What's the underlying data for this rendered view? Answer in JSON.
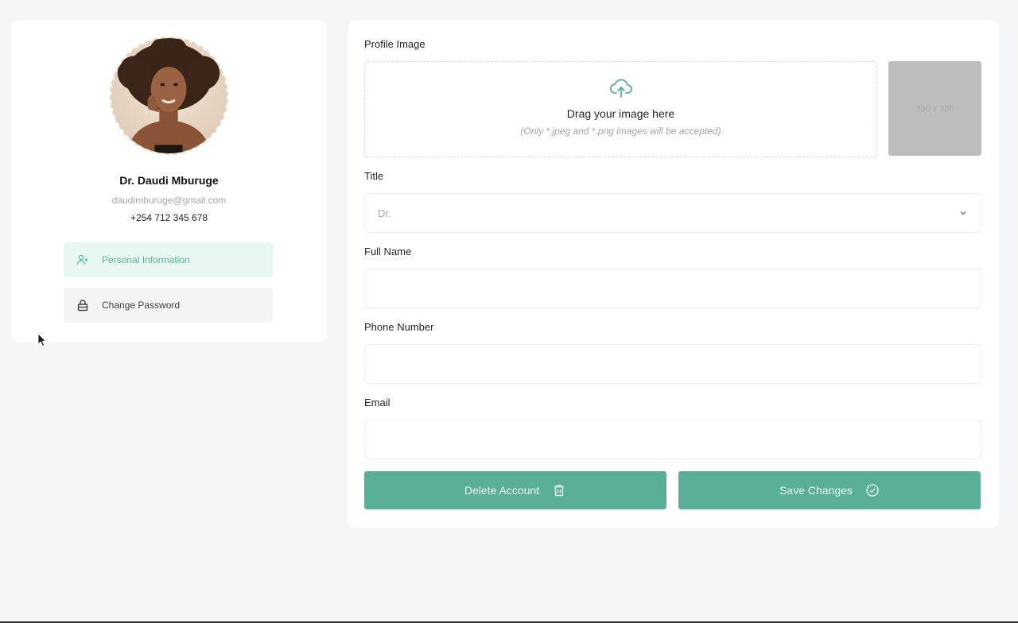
{
  "profile": {
    "name": "Dr. Daudi Mburuge",
    "email": "daudimburuge@gmail.com",
    "phone": "+254 712 345 678",
    "avatar_icon": "profile-photo"
  },
  "menu": {
    "items": [
      {
        "label": "Personal Information",
        "icon": "user-plus-icon",
        "active": true
      },
      {
        "label": "Change Password",
        "icon": "lock-icon",
        "active": false
      }
    ]
  },
  "form": {
    "profile_image_label": "Profile Image",
    "dropzone": {
      "title": "Drag your image here",
      "hint": "(Only *.jpeg and *.png images will be accepted)",
      "icon": "cloud-upload-icon"
    },
    "preview_placeholder": "300 x 300",
    "title_label": "Title",
    "title_value": "Dr.",
    "full_name_label": "Full Name",
    "full_name_value": "",
    "phone_label": "Phone Number",
    "phone_value": "",
    "email_label": "Email",
    "email_value": ""
  },
  "actions": {
    "delete_label": "Delete Account",
    "save_label": "Save Changes"
  },
  "colors": {
    "accent": "#5aaf98",
    "active_bg": "#e9f7f3",
    "page_bg": "#f5f6f8"
  }
}
